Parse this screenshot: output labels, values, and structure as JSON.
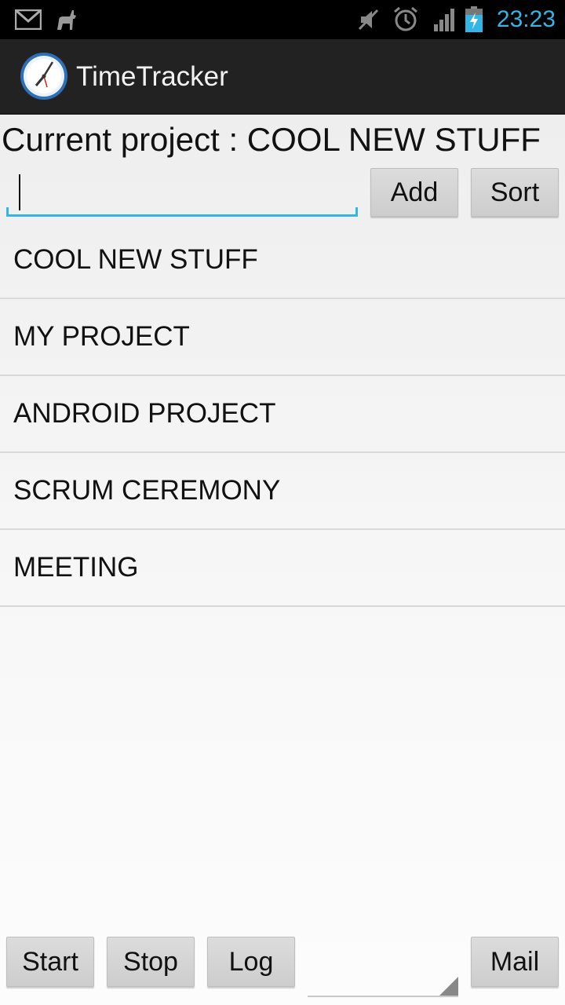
{
  "status_bar": {
    "time": "23:23",
    "icons": [
      "gmail-icon",
      "cat-icon",
      "mute-icon",
      "alarm-icon",
      "signal-icon",
      "battery-charging-icon"
    ],
    "accent_color": "#33b5e5"
  },
  "action_bar": {
    "title": "TimeTracker",
    "icon": "clock-icon"
  },
  "current_project": {
    "label": "Current project : COOL NEW STUFF"
  },
  "input": {
    "value": ""
  },
  "buttons": {
    "add": "Add",
    "sort": "Sort",
    "start": "Start",
    "stop": "Stop",
    "log": "Log",
    "mail": "Mail"
  },
  "projects": [
    "COOL NEW STUFF",
    "MY PROJECT",
    "ANDROID PROJECT",
    "SCRUM CEREMONY",
    "MEETING"
  ],
  "spinner": {
    "selected": ""
  }
}
